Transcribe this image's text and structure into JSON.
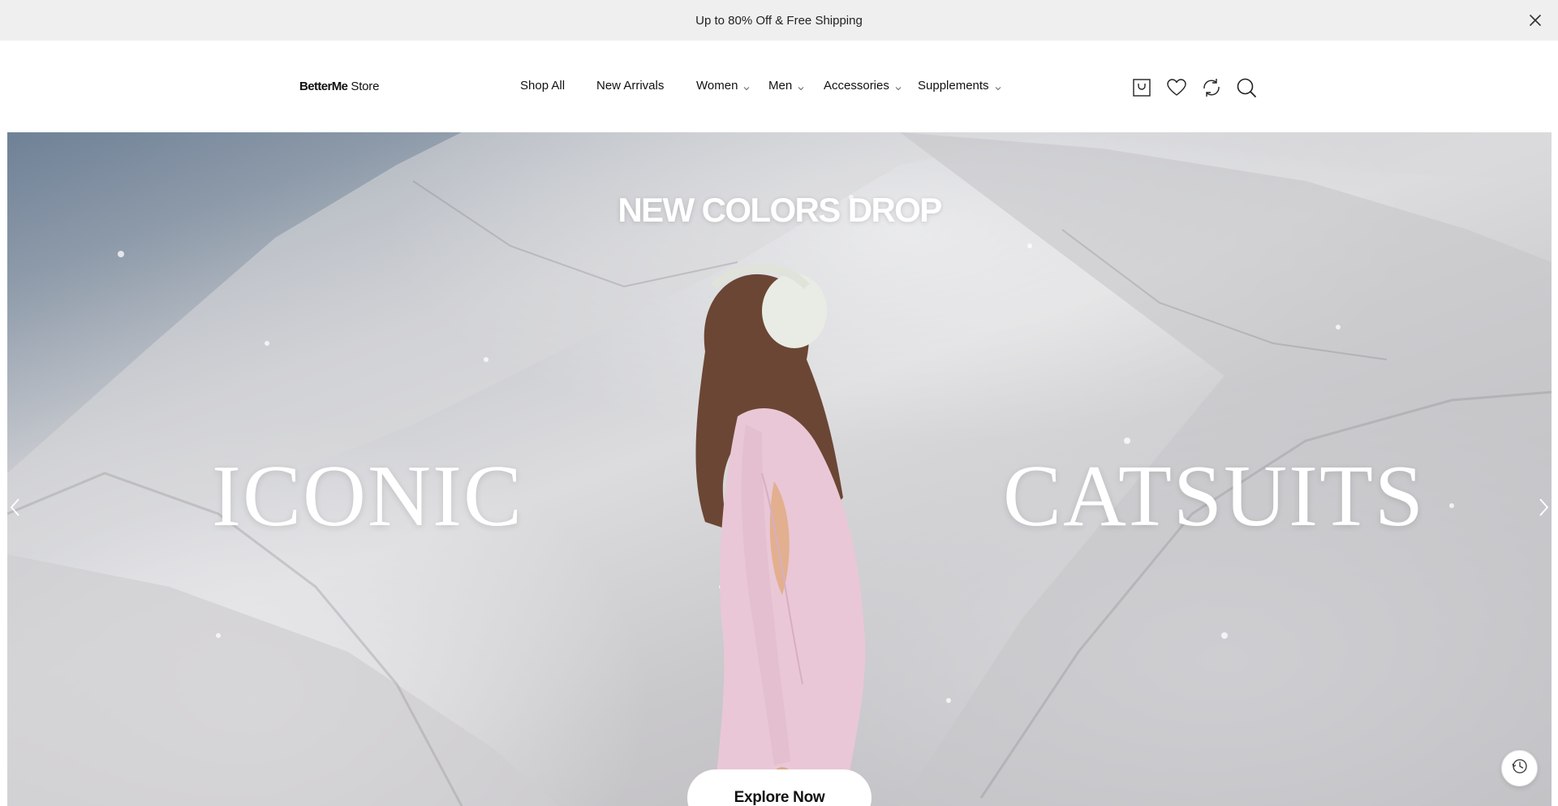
{
  "announcement": {
    "text": "Up to 80% Off & Free Shipping",
    "close_icon": "close-icon"
  },
  "header": {
    "logo_brand": "BetterMe",
    "logo_sub": "Store",
    "nav": [
      {
        "label": "Shop All",
        "has_dropdown": false
      },
      {
        "label": "New Arrivals",
        "has_dropdown": false
      },
      {
        "label": "Women",
        "has_dropdown": true
      },
      {
        "label": "Men",
        "has_dropdown": true
      },
      {
        "label": "Accessories",
        "has_dropdown": true
      },
      {
        "label": "Supplements",
        "has_dropdown": true
      }
    ],
    "icons": [
      "cart-icon",
      "heart-icon",
      "compare-icon",
      "search-icon"
    ]
  },
  "hero": {
    "kicker": "NEW COLORS DROP",
    "word_left": "ICONIC",
    "word_right": "CATSUITS",
    "cta_label": "Explore Now",
    "prev_icon": "chevron-left-icon",
    "next_icon": "chevron-right-icon"
  },
  "floating": {
    "history_icon": "history-icon"
  },
  "colors": {
    "announcement_bg": "#efefef",
    "text": "#111111",
    "hero_text": "#ffffff",
    "cta_bg": "#ffffff"
  }
}
